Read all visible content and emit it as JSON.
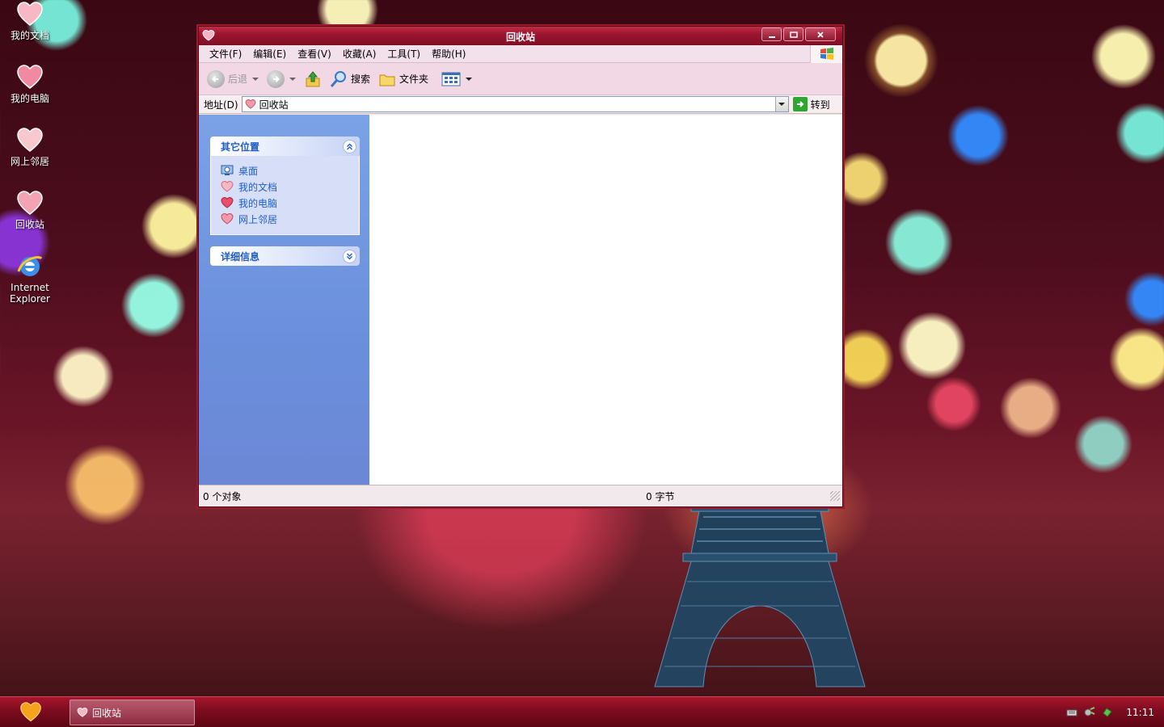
{
  "desktop": {
    "icons": [
      {
        "label": "我的文档",
        "icon": "heart-icon"
      },
      {
        "label": "我的电脑",
        "icon": "heart-icon"
      },
      {
        "label": "网上邻居",
        "icon": "heart-icon"
      },
      {
        "label": "回收站",
        "icon": "heart-icon"
      },
      {
        "label_line1": "Internet",
        "label_line2": "Explorer",
        "icon": "internet-explorer-icon"
      }
    ]
  },
  "window": {
    "title": "回收站",
    "menu": [
      "文件(F)",
      "编辑(E)",
      "查看(V)",
      "收藏(A)",
      "工具(T)",
      "帮助(H)"
    ],
    "toolbar": {
      "back": "后退",
      "search": "搜索",
      "folders": "文件夹"
    },
    "address": {
      "label": "地址(D)",
      "value": "回收站",
      "go": "转到"
    },
    "taskpane": {
      "other_places": {
        "title": "其它位置",
        "links": [
          "桌面",
          "我的文档",
          "我的电脑",
          "网上邻居"
        ]
      },
      "details": {
        "title": "详细信息"
      }
    },
    "status": {
      "objects": "0 个对象",
      "size": "0 字节"
    }
  },
  "taskbar": {
    "task_label": "回收站",
    "clock": "11:11"
  },
  "colors": {
    "titlebar": "#9c1530",
    "taskbar": "#7c0c1f",
    "taskpane": "#6b8fdc",
    "link": "#215dc6"
  }
}
